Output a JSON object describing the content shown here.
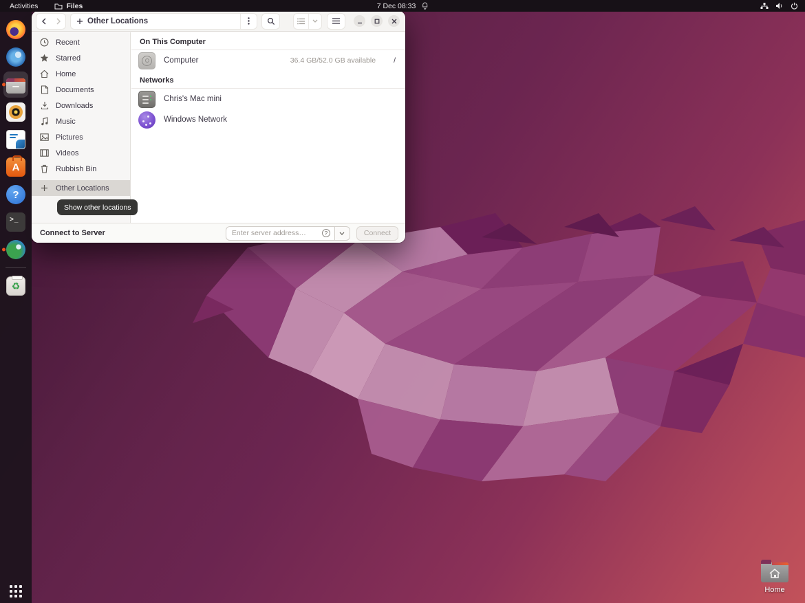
{
  "topbar": {
    "activities_label": "Activities",
    "app_menu_label": "Files",
    "clock": "7 Dec  08:33"
  },
  "dock": {
    "icons": [
      {
        "name": "firefox",
        "running": false
      },
      {
        "name": "thunderbird",
        "running": false
      },
      {
        "name": "files",
        "running": true,
        "active": true
      },
      {
        "name": "rhythmbox",
        "running": false
      },
      {
        "name": "libreoffice-writer",
        "running": false
      },
      {
        "name": "ubuntu-software",
        "running": false
      },
      {
        "name": "help",
        "running": false
      },
      {
        "name": "terminal",
        "running": false
      },
      {
        "name": "web-globe",
        "running": true
      },
      {
        "name": "rubbish-bin",
        "running": false
      }
    ],
    "terminal_glyph": ">_",
    "help_glyph": "?",
    "software_glyph": "A",
    "trash_glyph": "♻"
  },
  "window": {
    "header": {
      "path_label": "Other Locations"
    },
    "sidebar": {
      "items": [
        {
          "label": "Recent"
        },
        {
          "label": "Starred"
        },
        {
          "label": "Home"
        },
        {
          "label": "Documents"
        },
        {
          "label": "Downloads"
        },
        {
          "label": "Music"
        },
        {
          "label": "Pictures"
        },
        {
          "label": "Videos"
        },
        {
          "label": "Rubbish Bin"
        },
        {
          "label": "Other Locations"
        }
      ]
    },
    "tooltip": "Show other locations",
    "content": {
      "sections": [
        {
          "heading": "On This Computer",
          "items": [
            {
              "name": "Computer",
              "info": "36.4 GB/52.0 GB available",
              "path": "/"
            }
          ]
        },
        {
          "heading": "Networks",
          "items": [
            {
              "name": "Chris's Mac mini"
            },
            {
              "name": "Windows Network"
            }
          ]
        }
      ]
    },
    "footer": {
      "label": "Connect to Server",
      "placeholder": "Enter server address…",
      "connect_label": "Connect",
      "help_glyph": "?"
    }
  },
  "desktop": {
    "home_label": "Home"
  },
  "colors": {
    "accent_orange": "#e95420",
    "topbar_bg": "#171117",
    "sidebar_selected": "#dad7d3",
    "tooltip_bg": "#302f2d",
    "wallpaper_dark": "#3f1533",
    "wallpaper_mid": "#8c3158",
    "wallpaper_light": "#c2525a",
    "swirl_light": "#c48fb0",
    "swirl_mid": "#9a4a82",
    "swirl_dark": "#6b1f58"
  }
}
